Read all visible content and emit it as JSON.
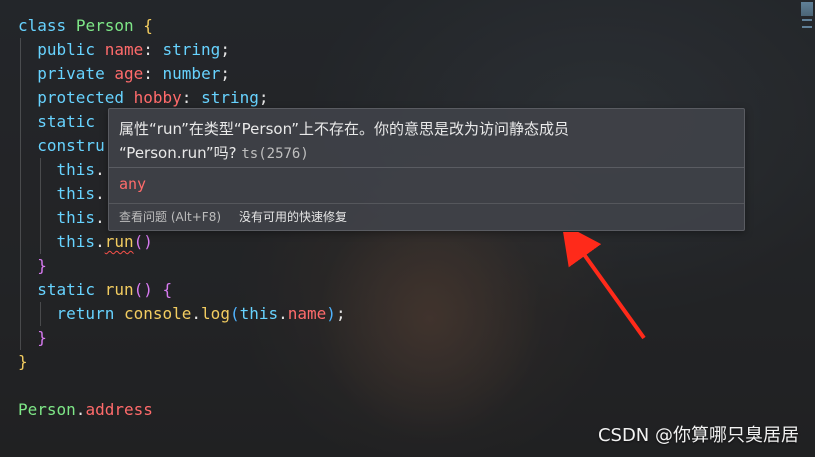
{
  "code": {
    "line1": {
      "kw": "class",
      "cls": "Person",
      "punc": "{"
    },
    "line2": {
      "kw": "public",
      "prop": "name",
      "colon": ":",
      "type": "string",
      "semi": ";"
    },
    "line3": {
      "kw": "private",
      "prop": "age",
      "colon": ":",
      "type": "number",
      "semi": ";"
    },
    "line4": {
      "kw": "protected",
      "prop": "hobby",
      "colon": ":",
      "type": "string",
      "semi": ";"
    },
    "line5": {
      "kw": "static"
    },
    "line6": {
      "kw": "constru"
    },
    "line7": {
      "kw": "this",
      "dot": "."
    },
    "line8": {
      "kw": "this",
      "dot": "."
    },
    "line9": {
      "kw": "this",
      "dot": "."
    },
    "line10": {
      "kw": "this",
      "dot": ".",
      "fn": "run",
      "parens": "()"
    },
    "line11": {
      "brace": "}"
    },
    "line12": {
      "kw": "static",
      "fn": "run",
      "parens": "()",
      "brace": "{"
    },
    "line13": {
      "kw": "return",
      "obj": "console",
      "dot": ".",
      "fn": "log",
      "open": "(",
      "this": "this",
      "dot2": ".",
      "prop": "name",
      "close": ")",
      "semi": ";"
    },
    "line14": {
      "brace": "}"
    },
    "line15": {
      "brace": "}"
    },
    "line17": {
      "cls": "Person",
      "dot": ".",
      "prop": "address"
    }
  },
  "tooltip": {
    "message_part1": "属性“run”在类型“Person”上不存在。你的意思是改为访问静态成员",
    "message_part2": "“Person.run”吗?",
    "code": "ts(2576)",
    "type": "any",
    "view_problem": "查看问题 (Alt+F8)",
    "no_quick_fix": "没有可用的快速修复"
  },
  "watermark": "CSDN @你算哪只臭居居",
  "colors": {
    "keyword": "#67d3ff",
    "class": "#7ee787",
    "property": "#ff6b6b",
    "type": "#f2cc60",
    "arrow": "#ff2a1a"
  }
}
